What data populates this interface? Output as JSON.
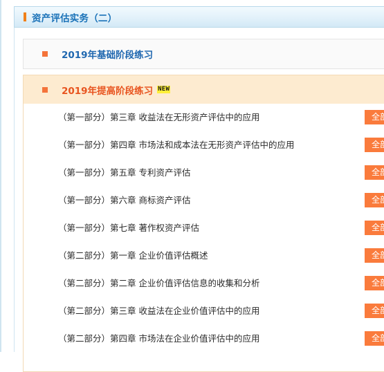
{
  "header": {
    "title": "资产评估实务（二）",
    "marker_color": "#f08019",
    "title_color": "#1a72b8"
  },
  "sections": [
    {
      "name": "basic-stage",
      "title": "2019年基础阶段练习",
      "expanded": false,
      "bullet_color": "#f4733a",
      "title_color": "#2068b0",
      "badge": null,
      "lessons": []
    },
    {
      "name": "advanced-stage",
      "title": "2019年提高阶段练习",
      "expanded": true,
      "bullet_color": "#f4733a",
      "title_color": "#e8541f",
      "badge": "NEW",
      "badge_bg": "#ffef3a",
      "lessons": [
        {
          "title": "（第一部分）第三章  收益法在无形资产评估中的应用",
          "action": "全部"
        },
        {
          "title": "（第一部分）第四章   市场法和成本法在无形资产评估中的应用",
          "action": "全部"
        },
        {
          "title": "（第一部分）第五章   专利资产评估",
          "action": "全部"
        },
        {
          "title": "（第一部分）第六章   商标资产评估",
          "action": "全部"
        },
        {
          "title": "（第一部分）第七章   著作权资产评估",
          "action": "全部"
        },
        {
          "title": "（第二部分）第一章  企业价值评估概述",
          "action": "全部"
        },
        {
          "title": "（第二部分）第二章  企业价值评估信息的收集和分析",
          "action": "全部"
        },
        {
          "title": "（第二部分）第三章  收益法在企业价值评估中的应用",
          "action": "全部"
        },
        {
          "title": "（第二部分）第四章  市场法在企业价值评估中的应用",
          "action": "全部"
        }
      ]
    }
  ],
  "colors": {
    "accent_orange": "#fa7b3c",
    "header_blue": "#1a72b8",
    "expanded_bg": "#fdebd0",
    "collapsed_bg": "#fafafa"
  }
}
